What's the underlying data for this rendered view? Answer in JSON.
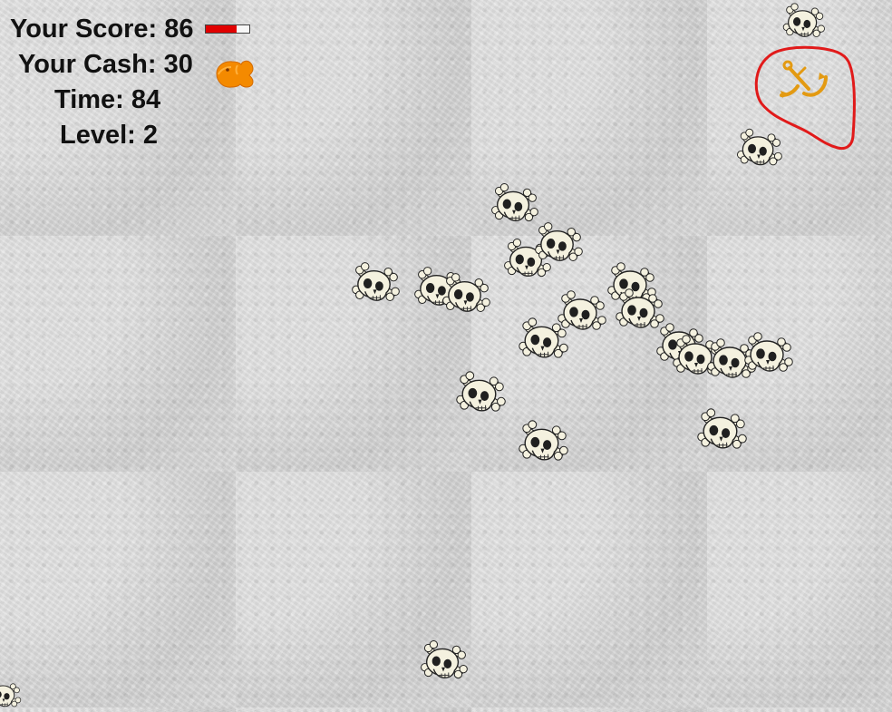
{
  "hud": {
    "score_label": "Your Score: 86",
    "score": 86,
    "score_fill_percent": 70,
    "cash_label": "Your Cash: 30",
    "cash": 30,
    "time_label": "Time: 84",
    "time": 84,
    "level_label": "Level: 2",
    "level": 2
  },
  "colors": {
    "score_bar_fill": "#e10000",
    "score_bar_background": "#f7f7f7",
    "cash_icon": "#f48a00",
    "anchor": "#e39a12",
    "circle": "#e11a1a",
    "skull": "#f4f1df",
    "shadow": "#202020"
  },
  "icons": {
    "cash": "orange-fish-icon",
    "anchor": "anchor-icon",
    "enemy": "skull-crossbones-icon"
  }
}
